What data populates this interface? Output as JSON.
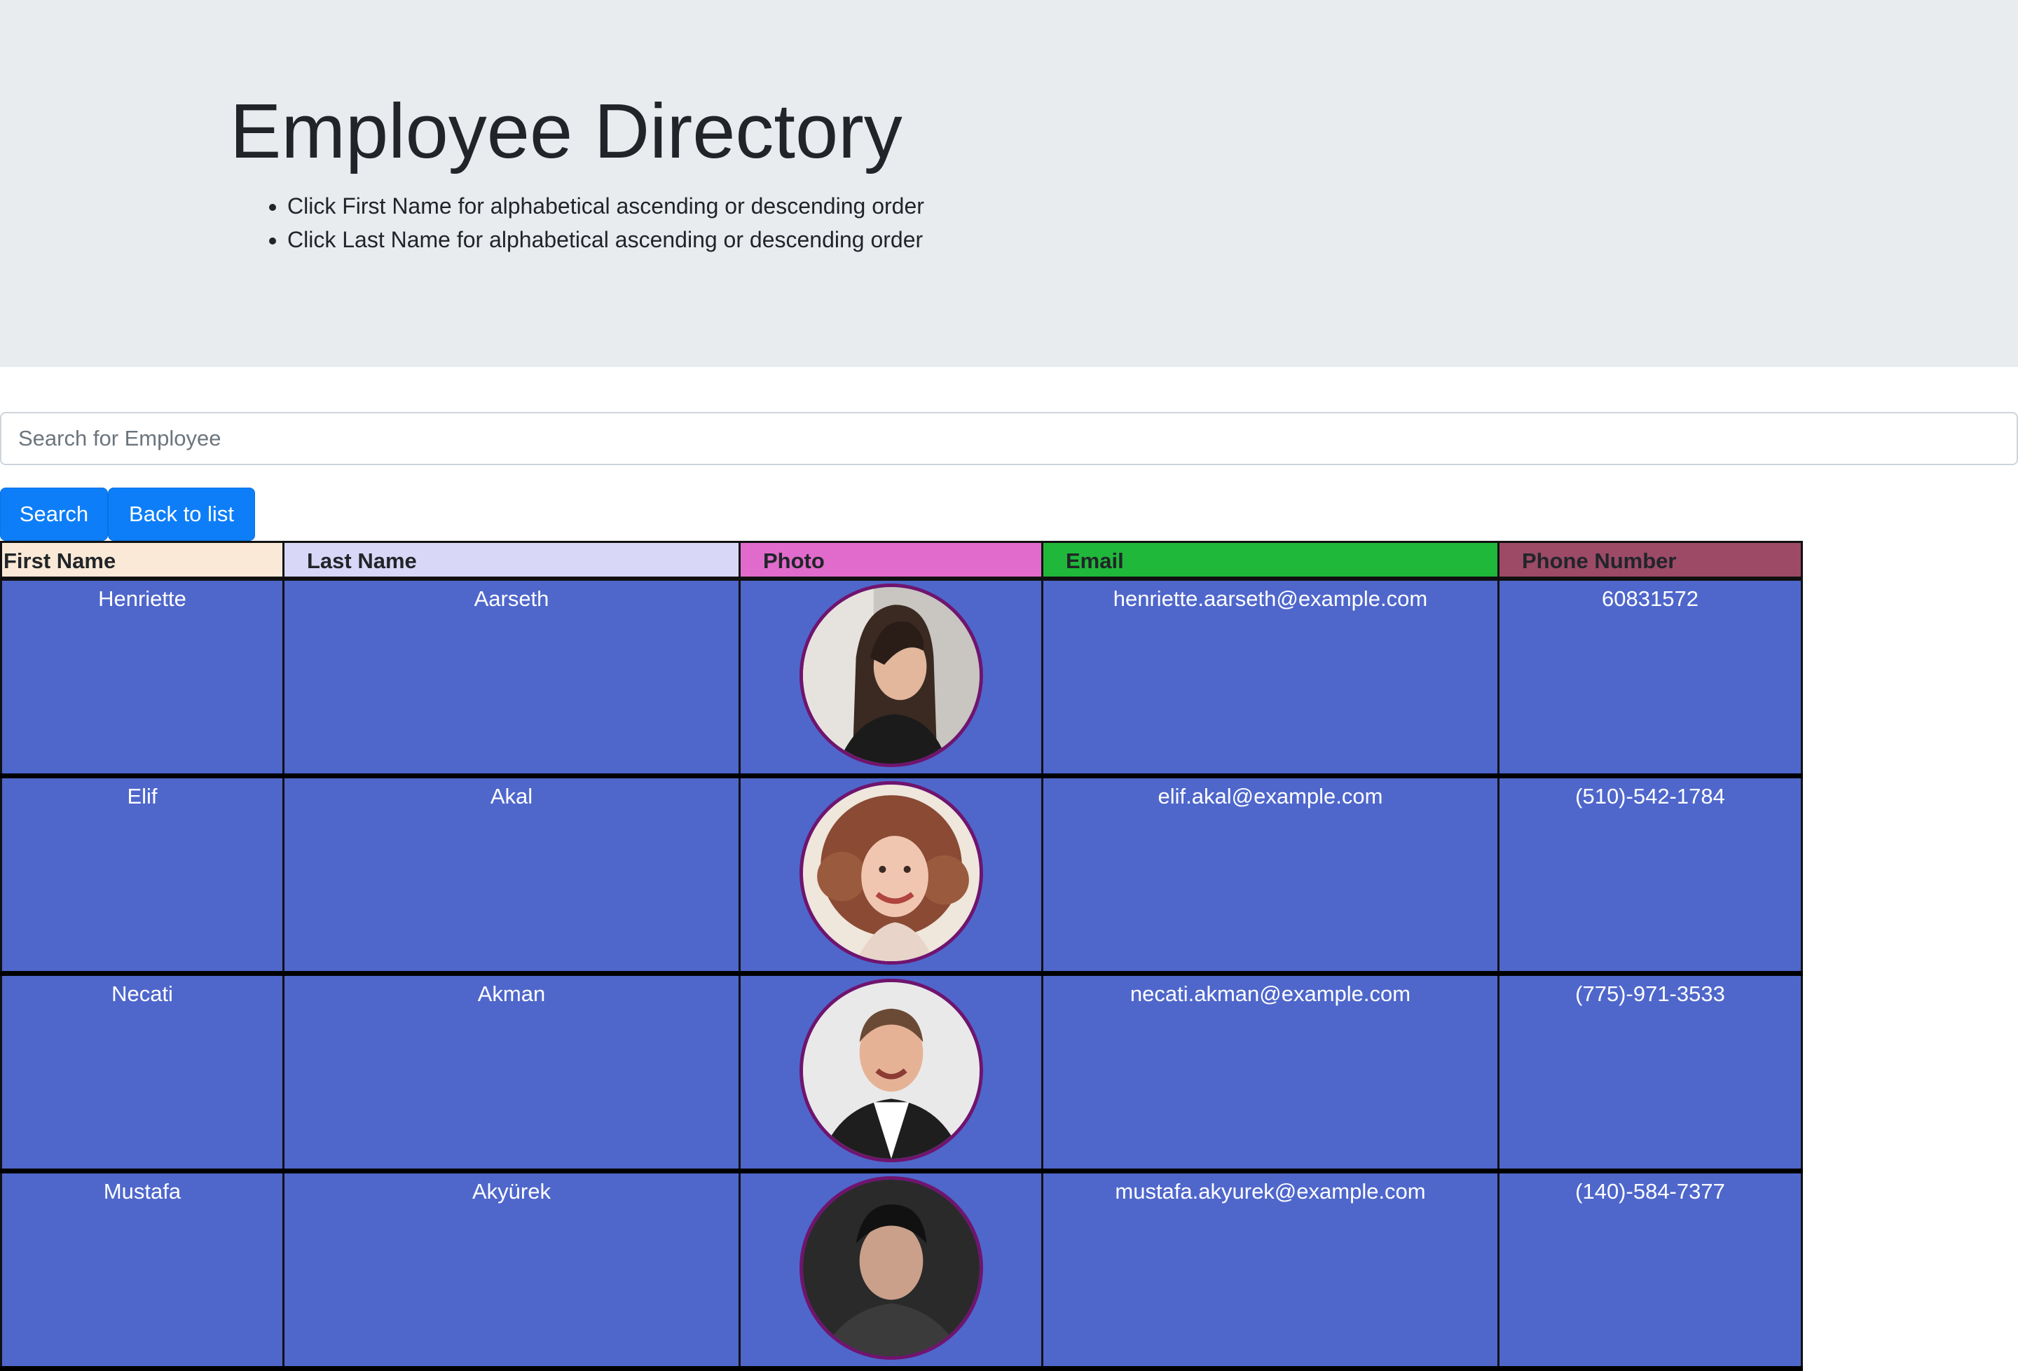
{
  "header": {
    "title": "Employee Directory",
    "instructions": [
      "Click First Name for alphabetical ascending or descending order",
      "Click Last Name for alphabetical ascending or descending order"
    ]
  },
  "search": {
    "placeholder": "Search for Employee",
    "value": "",
    "search_button": "Search",
    "back_button": "Back to list"
  },
  "table": {
    "columns": [
      {
        "label": "First Name",
        "color": "#fbe9d7"
      },
      {
        "label": "Last Name",
        "color": "#d8d7f7"
      },
      {
        "label": "Photo",
        "color": "#e16bcc"
      },
      {
        "label": "Email",
        "color": "#20b83a"
      },
      {
        "label": "Phone Number",
        "color": "#9c4a66"
      }
    ],
    "row_color": "#4f67cb",
    "rows": [
      {
        "first": "Henriette",
        "last": "Aarseth",
        "photo": "portrait-woman-dark-hair-icon",
        "email": "henriette.aarseth@example.com",
        "phone": "60831572"
      },
      {
        "first": "Elif",
        "last": "Akal",
        "photo": "portrait-woman-curly-hair-icon",
        "email": "elif.akal@example.com",
        "phone": "(510)-542-1784"
      },
      {
        "first": "Necati",
        "last": "Akman",
        "photo": "portrait-man-short-hair-icon",
        "email": "necati.akman@example.com",
        "phone": "(775)-971-3533"
      },
      {
        "first": "Mustafa",
        "last": "Akyürek",
        "photo": "portrait-man-icon",
        "email": "mustafa.akyurek@example.com",
        "phone": "(140)-584-7377"
      }
    ]
  }
}
